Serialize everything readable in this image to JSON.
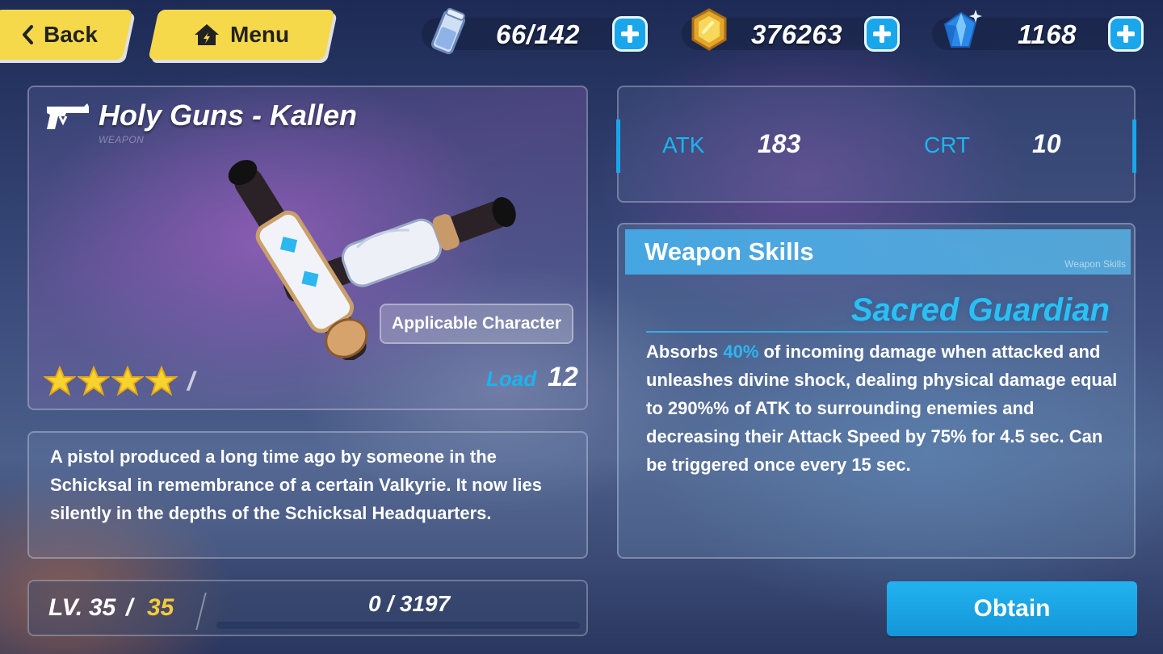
{
  "nav": {
    "back_label": "Back",
    "menu_label": "Menu"
  },
  "currencies": {
    "stamina": {
      "icon": "stamina-icon",
      "value": "66/142"
    },
    "coins": {
      "icon": "coin-icon",
      "value": "376263"
    },
    "crystals": {
      "icon": "crystal-icon",
      "value": "1168"
    }
  },
  "weapon": {
    "name": "Holy Guns - Kallen",
    "type_label": "WEAPON",
    "applicable_label": "Applicable Character",
    "stars": 4,
    "star_suffix": "/",
    "load_label": "Load",
    "load_value": "12",
    "description": "A pistol produced a long time ago by someone in the Schicksal in remembrance of a certain Valkyrie. It now lies silently in the depths of the Schicksal Headquarters."
  },
  "level": {
    "label": "LV.",
    "current": "35",
    "separator": "/",
    "max": "35",
    "exp_text": "0 / 3197",
    "exp_fraction": 0
  },
  "stats": {
    "atk_label": "ATK",
    "atk_value": "183",
    "crt_label": "CRT",
    "crt_value": "10"
  },
  "skills": {
    "header": "Weapon Skills",
    "header_sub": "Weapon Skills",
    "skill_name": "Sacred Guardian",
    "desc_prefix": "Absorbs ",
    "desc_highlight": "40%",
    "desc_rest": " of incoming damage when attacked and unleashes divine shock, dealing physical damage equal to 290%% of ATK to surrounding enemies and decreasing their Attack Speed by 75% for 4.5 sec. Can be triggered once every 15 sec."
  },
  "obtain_label": "Obtain",
  "colors": {
    "accent_blue": "#1aa6ea",
    "nav_yellow": "#f6d94a",
    "max_level_gold": "#f2cc3d",
    "star_yellow": "#f7d330"
  }
}
